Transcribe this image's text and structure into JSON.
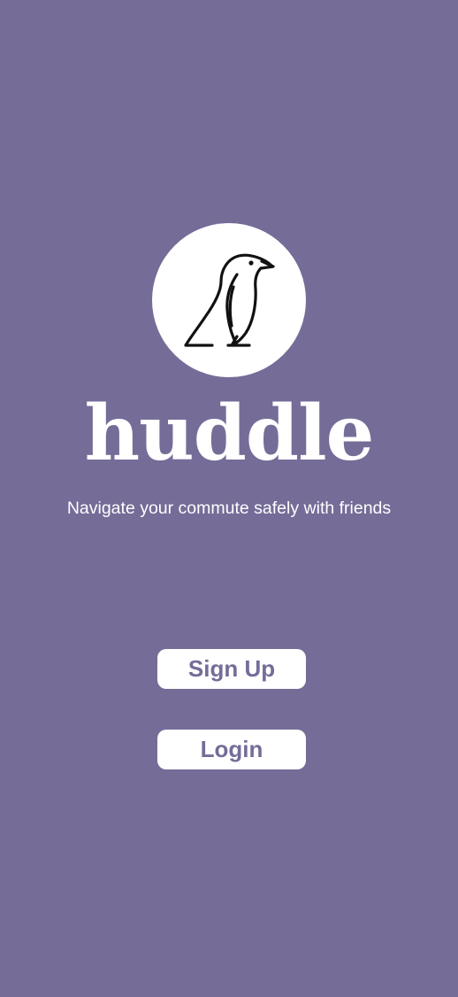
{
  "app": {
    "name": "huddle",
    "tagline": "Navigate your commute safely with friends",
    "logo_icon": "penguin-icon"
  },
  "actions": {
    "signup_label": "Sign Up",
    "login_label": "Login"
  },
  "colors": {
    "background": "#756c98",
    "button_bg": "#ffffff",
    "button_text": "#756c98",
    "text": "#ffffff"
  }
}
